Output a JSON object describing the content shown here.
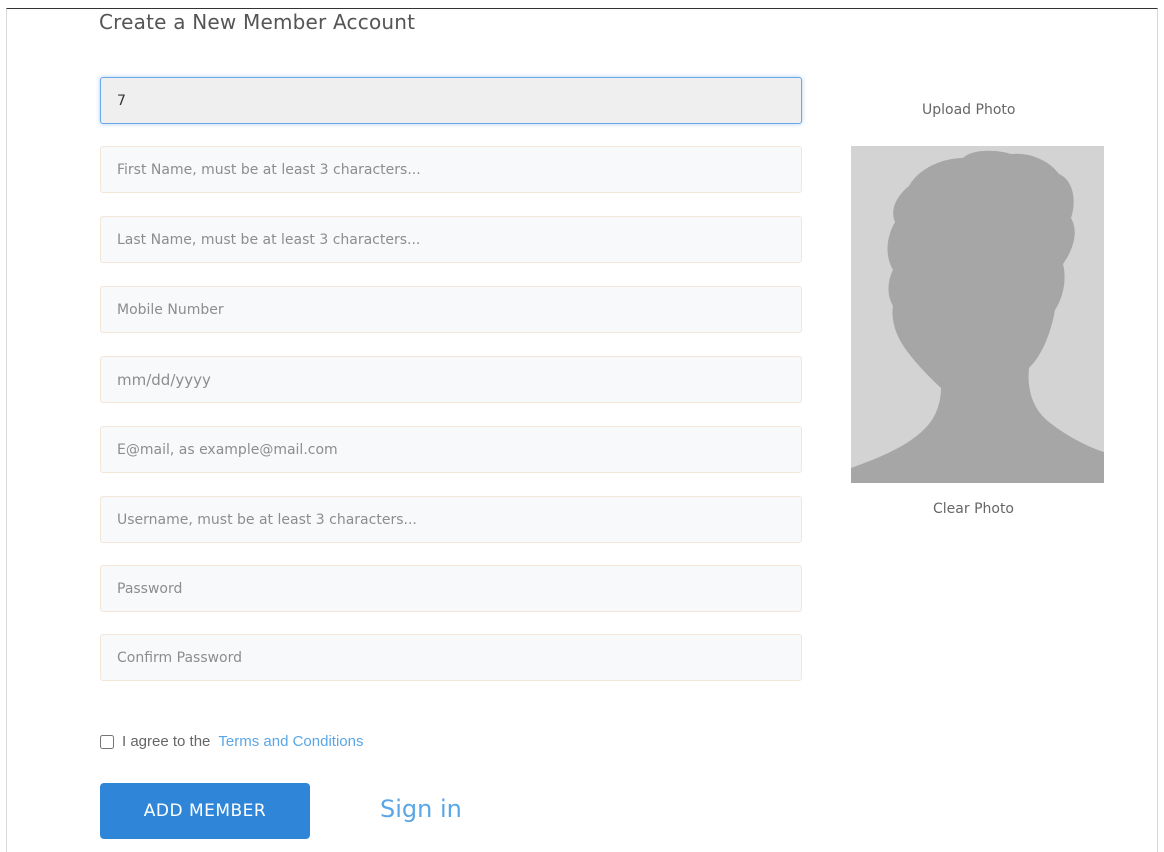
{
  "page_title": "Create a New Member Account",
  "form": {
    "member_id": {
      "value": "7"
    },
    "first_name": {
      "placeholder": "First Name, must be at least 3 characters..."
    },
    "last_name": {
      "placeholder": "Last Name, must be at least 3 characters..."
    },
    "mobile": {
      "placeholder": "Mobile Number"
    },
    "dob": {
      "placeholder": "mm/dd/yyyy"
    },
    "email": {
      "placeholder": "E@mail, as example@mail.com"
    },
    "username": {
      "placeholder": "Username, must be at least 3 characters..."
    },
    "password": {
      "placeholder": "Password"
    },
    "confirm_password": {
      "placeholder": "Confirm Password"
    }
  },
  "photo": {
    "upload_label": "Upload Photo",
    "clear_label": "Clear Photo",
    "icon": "avatar-silhouette"
  },
  "agreement": {
    "prefix": "I agree to the",
    "link_text": "Terms and Conditions",
    "checked": false
  },
  "actions": {
    "add_member_label": "ADD MEMBER",
    "sign_in_label": "Sign in"
  },
  "colors": {
    "primary_button": "#2f86d8",
    "link": "#5aa6e6",
    "focus_border": "#6aa9e6"
  }
}
